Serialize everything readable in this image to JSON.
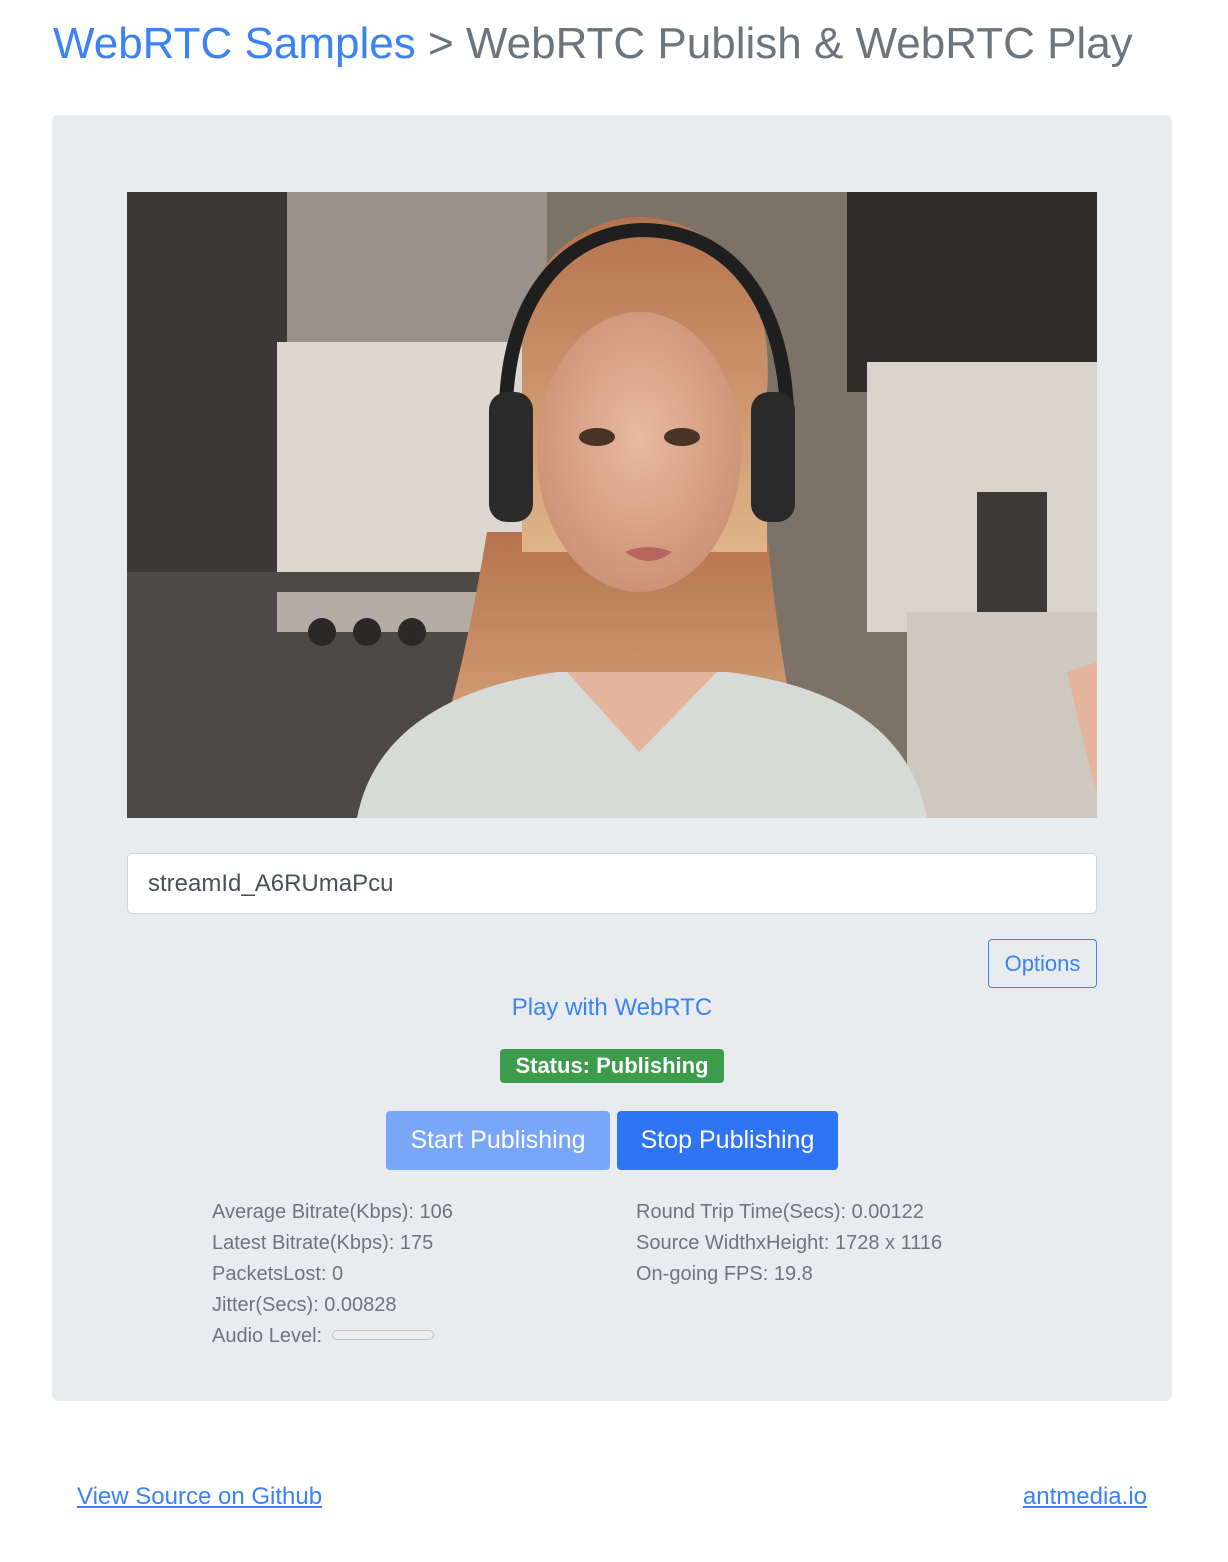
{
  "header": {
    "home_link": "WebRTC Samples",
    "separator": " > ",
    "page_title": "WebRTC Publish & WebRTC Play"
  },
  "stream": {
    "stream_id_value": "streamId_A6RUmaPcu"
  },
  "options_label": "Options",
  "play_link": "Play with WebRTC",
  "status": {
    "text": "Status: Publishing",
    "color": "#3c9c4c"
  },
  "buttons": {
    "start_label": "Start Publishing",
    "stop_label": "Stop Publishing"
  },
  "stats": {
    "left": [
      "Average Bitrate(Kbps): 106",
      "Latest Bitrate(Kbps): 175",
      "PacketsLost: 0",
      "Jitter(Secs): 0.00828"
    ],
    "audio_level_label": "Audio Level:",
    "audio_level": 0,
    "right": [
      "Round Trip Time(Secs): 0.00122",
      "Source WidthxHeight: 1728 x 1116",
      "On-going FPS: 19.8"
    ]
  },
  "footer": {
    "source_link": "View Source on Github",
    "site_link": "antmedia.io"
  },
  "colors": {
    "accent": "#3b82f6",
    "panel_bg": "#e9ecef",
    "start_button": "#79a6f8",
    "stop_button": "#2f74f2"
  }
}
